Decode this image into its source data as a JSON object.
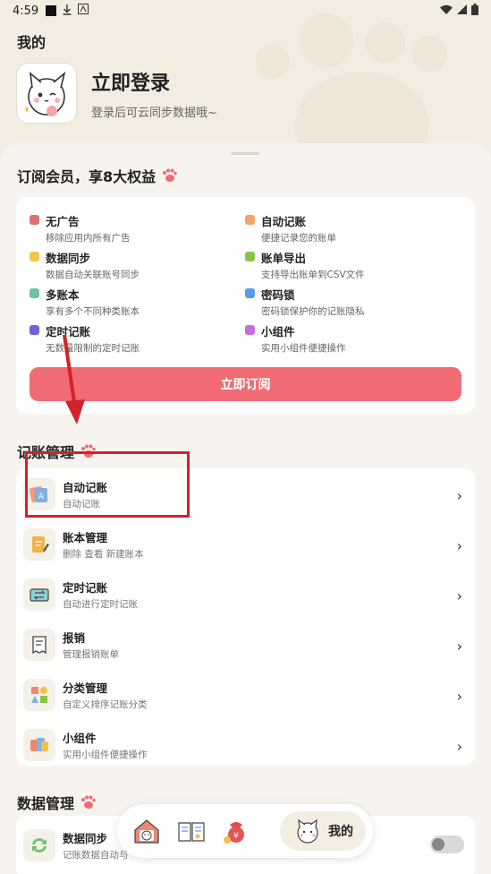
{
  "status_bar": {
    "time": "4:59"
  },
  "header": {
    "title": "我的",
    "login_title": "立即登录",
    "login_subtitle": "登录后可云同步数据哦~"
  },
  "vip": {
    "title": "订阅会员，享8大权益",
    "benefits": [
      {
        "name": "无广告",
        "desc": "移除应用内所有广告",
        "color": "#e06c74"
      },
      {
        "name": "自动记账",
        "desc": "便捷记录您的账单",
        "color": "#f2a36b"
      },
      {
        "name": "数据同步",
        "desc": "数据自动关联账号同步",
        "color": "#f1c74a"
      },
      {
        "name": "账单导出",
        "desc": "支持导出账单到CSV文件",
        "color": "#8bc34a"
      },
      {
        "name": "多账本",
        "desc": "享有多个不同种类账本",
        "color": "#6cc3a0"
      },
      {
        "name": "密码锁",
        "desc": "密码锁保护你的记账隐私",
        "color": "#5b9be6"
      },
      {
        "name": "定时记账",
        "desc": "无数量限制的定时记账",
        "color": "#6f63d9"
      },
      {
        "name": "小组件",
        "desc": "实用小组件便捷操作",
        "color": "#c36fd9"
      }
    ],
    "subscribe_label": "立即订阅"
  },
  "manage": {
    "title": "记账管理",
    "items": [
      {
        "title": "自动记账",
        "subtitle": "自动记账",
        "icon": "auto-accounting-icon"
      },
      {
        "title": "账本管理",
        "subtitle": "删除 查看 新建账本",
        "icon": "ledger-icon"
      },
      {
        "title": "定时记账",
        "subtitle": "自动进行定时记账",
        "icon": "scheduled-icon"
      },
      {
        "title": "报销",
        "subtitle": "管理报销账单",
        "icon": "reimburse-icon"
      },
      {
        "title": "分类管理",
        "subtitle": "自定义排序记账分类",
        "icon": "category-icon"
      },
      {
        "title": "小组件",
        "subtitle": "实用小组件便捷操作",
        "icon": "widget-icon"
      }
    ]
  },
  "data_manage": {
    "title": "数据管理",
    "sync_title": "数据同步",
    "sync_subtitle": "记账数据自动与"
  },
  "nav": {
    "mine_label": "我的"
  },
  "colors": {
    "accent": "#f06b74",
    "annotation": "#d2222b"
  }
}
